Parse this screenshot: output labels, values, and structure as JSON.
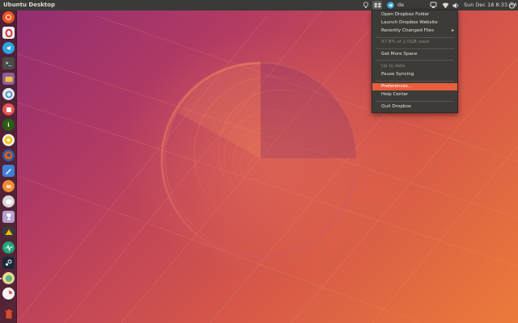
{
  "panel": {
    "title": "Ubuntu Desktop",
    "keyboard_layout": "de",
    "datetime": "Sun Dec 18  8:33 PM"
  },
  "tray_icons": [
    "lightbulb-icon",
    "dropbox-icon",
    "telegram-icon",
    "keyboard-icon",
    "network-icon",
    "wifi-icon",
    "volume-icon",
    "power-icon"
  ],
  "launcher": {
    "items": [
      {
        "name": "ubuntu-software",
        "color": "#e95420"
      },
      {
        "name": "opera",
        "color": "#e0e0e0"
      },
      {
        "name": "telegram",
        "color": "#2ca5e0"
      },
      {
        "name": "terminal",
        "color": "#4a4a48"
      },
      {
        "name": "files",
        "color": "#8b5e9a"
      },
      {
        "name": "settings",
        "color": "#5ba0d0"
      },
      {
        "name": "screenshot",
        "color": "#e6534f"
      },
      {
        "name": "info",
        "color": "#5a8f2a"
      },
      {
        "name": "chrome",
        "color": "#f5c518"
      },
      {
        "name": "firefox",
        "color": "#e66000"
      },
      {
        "name": "writer",
        "color": "#3f7fd6"
      },
      {
        "name": "notes",
        "color": "#f08a30"
      },
      {
        "name": "disks",
        "color": "#e8e8e8"
      },
      {
        "name": "trophy",
        "color": "#b3a0cc"
      },
      {
        "name": "network-manager",
        "color": "#f5b800"
      },
      {
        "name": "system-monitor",
        "color": "#1fa57a"
      },
      {
        "name": "steam",
        "color": "#2a2a2a"
      },
      {
        "name": "maps",
        "color": "#6fbf4e"
      },
      {
        "name": "pie-chart",
        "color": "#e8e8e8"
      },
      {
        "name": "trash",
        "color": "#d94c2c"
      }
    ]
  },
  "dropbox_menu": {
    "items": [
      {
        "label": "Open Dropbox Folder",
        "state": "normal"
      },
      {
        "label": "Launch Dropbox Website",
        "state": "normal"
      },
      {
        "label": "Recently Changed Files",
        "state": "normal",
        "submenu": true
      },
      {
        "label": "97.8% of 2.0GB used",
        "state": "disabled"
      },
      {
        "label": "Get More Space",
        "state": "normal"
      },
      {
        "label": "Up to date",
        "state": "disabled"
      },
      {
        "label": "Pause Syncing",
        "state": "normal"
      },
      {
        "label": "Preferences...",
        "state": "highlight"
      },
      {
        "label": "Help Center",
        "state": "normal"
      },
      {
        "label": "Quit Dropbox",
        "state": "normal"
      }
    ],
    "submenu_arrow": "▸"
  },
  "colors": {
    "accent": "#e95e3c",
    "panel": "#3a3a38",
    "menu": "#3c3b37"
  }
}
